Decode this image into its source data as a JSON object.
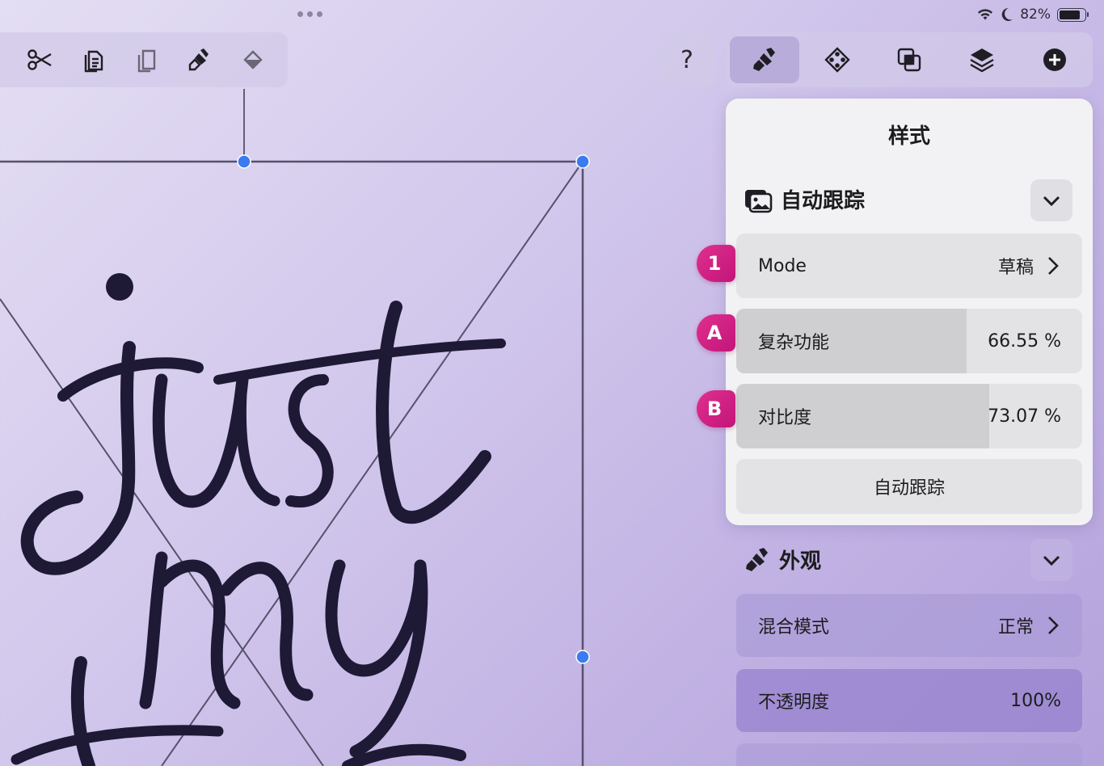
{
  "status_bar": {
    "battery_percent": "82%",
    "battery_level": 0.82
  },
  "toolbar_left": {
    "tools": [
      {
        "name": "scissors-icon"
      },
      {
        "name": "copy-icon"
      },
      {
        "name": "paste-icon"
      },
      {
        "name": "paste-style-icon"
      },
      {
        "name": "fill-icon"
      }
    ]
  },
  "help": {
    "label": "?"
  },
  "toolbar_right": {
    "tabs": [
      {
        "name": "style-brush-icon",
        "active": true
      },
      {
        "name": "transform-diamond-icon",
        "active": false
      },
      {
        "name": "boolean-ops-icon",
        "active": false
      },
      {
        "name": "layers-icon",
        "active": false
      },
      {
        "name": "add-icon",
        "active": false
      }
    ]
  },
  "panel": {
    "title": "样式",
    "auto_trace": {
      "header": "自动跟踪",
      "mode": {
        "label": "Mode",
        "value": "草稿",
        "badge": "1"
      },
      "complexity": {
        "label": "复杂功能",
        "value": "66.55 %",
        "fill": 0.6655,
        "badge": "A"
      },
      "contrast": {
        "label": "对比度",
        "value": "73.07 %",
        "fill": 0.7307,
        "badge": "B"
      },
      "action": {
        "label": "自动跟踪"
      }
    },
    "appearance": {
      "header": "外观",
      "blend_mode": {
        "label": "混合模式",
        "value": "正常"
      },
      "opacity": {
        "label": "不透明度",
        "value": "100%"
      }
    }
  },
  "colors": {
    "accent_handle": "#3b7bf0",
    "badge": "#d8207f"
  }
}
